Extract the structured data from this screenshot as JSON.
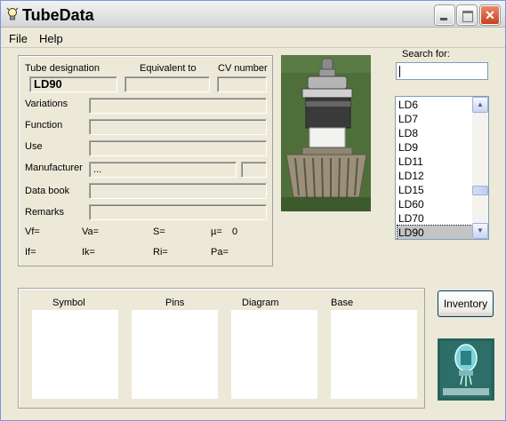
{
  "window": {
    "title": "TubeData"
  },
  "menu": {
    "file": "File",
    "help": "Help"
  },
  "details": {
    "headers": {
      "designation": "Tube designation",
      "equivalent": "Equivalent to",
      "cv": "CV number"
    },
    "designation_value": "LD90",
    "rows": {
      "variations": "Variations",
      "function": "Function",
      "use": "Use",
      "manufacturer": "Manufacturer",
      "databook": "Data book",
      "remarks": "Remarks"
    },
    "manufacturer_value": "...",
    "params": {
      "vf": "Vf=",
      "va": "Va=",
      "s": "S=",
      "mu": "µ=",
      "mu_value": "0",
      "if": "If=",
      "ik": "Ik=",
      "ri": "Ri=",
      "pa": "Pa="
    }
  },
  "search": {
    "label": "Search for:",
    "value": ""
  },
  "tube_list": {
    "items": [
      "LD6",
      "LD7",
      "LD8",
      "LD9",
      "LD11",
      "LD12",
      "LD15",
      "LD60",
      "LD70",
      "LD90"
    ],
    "selected": "LD90"
  },
  "panels": {
    "symbol": "Symbol",
    "pins": "Pins",
    "diagram": "Diagram",
    "base": "Base"
  },
  "buttons": {
    "inventory": "Inventory"
  },
  "colors": {
    "selection": "#c4c4c4",
    "photo_bg": "#4f6f3a",
    "logo_bg": "#2e6e68"
  }
}
